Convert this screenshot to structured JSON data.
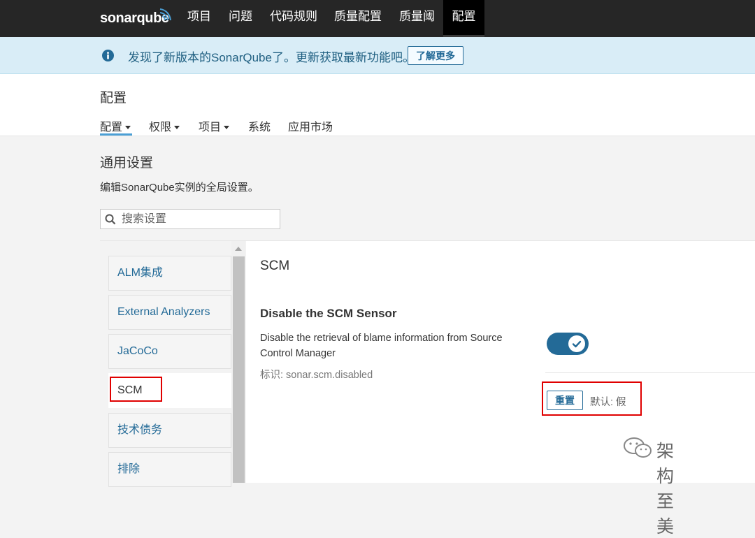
{
  "topnav": {
    "logo": "sonarqube",
    "items": [
      {
        "label": "项目"
      },
      {
        "label": "问题"
      },
      {
        "label": "代码规则"
      },
      {
        "label": "质量配置"
      },
      {
        "label": "质量阈"
      },
      {
        "label": "配置"
      }
    ],
    "active_index": 5
  },
  "banner": {
    "icon": "info-icon",
    "text": "发现了新版本的SonarQube了。更新获取最新功能吧。",
    "button_label": "了解更多"
  },
  "page_header": {
    "title": "配置",
    "tabs": [
      {
        "label": "配置",
        "has_dropdown": true
      },
      {
        "label": "权限",
        "has_dropdown": true
      },
      {
        "label": "项目",
        "has_dropdown": true
      },
      {
        "label": "系统",
        "has_dropdown": false
      },
      {
        "label": "应用市场",
        "has_dropdown": false
      }
    ],
    "active_tab": 0
  },
  "content": {
    "title": "通用设置",
    "description": "编辑SonarQube实例的全局设置。",
    "search": {
      "placeholder": "搜索设置",
      "value": ""
    }
  },
  "sidebar": {
    "items": [
      {
        "label": "ALM集成"
      },
      {
        "label": "External Analyzers"
      },
      {
        "label": "JaCoCo"
      },
      {
        "label": "SCM"
      },
      {
        "label": "技术债务"
      },
      {
        "label": "排除"
      }
    ],
    "active_index": 3
  },
  "panel": {
    "title": "SCM",
    "setting": {
      "title": "Disable the SCM Sensor",
      "description": "Disable the retrieval of blame information from Source Control Manager",
      "key_label": "标识: sonar.scm.disabled",
      "toggle_on": true,
      "reset_label": "重置",
      "default_label": "默认: 假"
    }
  },
  "watermark": {
    "text": "架构至美"
  },
  "colors": {
    "accent": "#236a97",
    "nav_bg": "#262626",
    "banner_bg": "#d9edf7",
    "highlight": "#e00000"
  }
}
